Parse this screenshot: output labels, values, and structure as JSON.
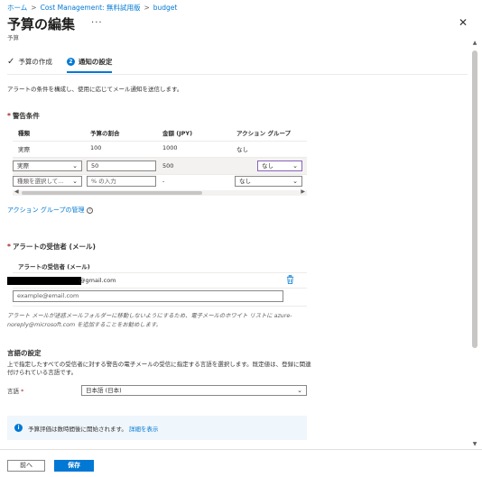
{
  "breadcrumb": [
    "ホーム",
    "Cost Management: 無料試用版",
    "budget"
  ],
  "header": {
    "title": "予算の編集",
    "more": "···",
    "subtitle": "予算",
    "close": "✕"
  },
  "steps": [
    {
      "label": "予算の作成",
      "state": "done"
    },
    {
      "label": "通知の設定",
      "number": "2",
      "state": "active"
    }
  ],
  "description": "アラートの条件を構成し、使用に応じてメール通知を送信します。",
  "alert_conditions": {
    "required_mark": "*",
    "title": "警告条件",
    "columns": [
      "種類",
      "予算の割合",
      "金額 (JPY)",
      "アクション グループ"
    ],
    "rows": [
      {
        "type": "実際",
        "percent": "100",
        "amount": "1000",
        "action_group": "なし"
      },
      {
        "type": "実際",
        "percent": "50",
        "amount": "500",
        "action_group": "なし"
      },
      {
        "type_placeholder": "種類を選択して...",
        "percent_placeholder": "% の入力",
        "amount": "-",
        "action_group": "なし"
      }
    ],
    "manage_link": "アクション グループの管理"
  },
  "recipients": {
    "required_mark": "*",
    "title": "アラートの受信者 (メール)",
    "column": "アラートの受信者 (メール)",
    "email_suffix": "@gmail.com",
    "placeholder": "example@email.com",
    "note": "アラート メールが迷惑メールフォルダーに移動しないようにするため、電子メールのホワイト リストに azure-noreply@microsoft.com を追加することをお勧めします。"
  },
  "language": {
    "title": "言語の設定",
    "description": "上で指定したすべての受信者に対する警告の電子メールの受信に指定する言語を選択します。既定値は、登録に関連付けられている言語です。",
    "label": "言語",
    "required_mark": "*",
    "value": "日本語 (日本)"
  },
  "info": {
    "icon": "i",
    "text": "予算評価は数時間後に開始されます。",
    "link": "詳細を表示"
  },
  "footer": {
    "prev": "前へ",
    "save": "保存"
  },
  "colors": {
    "accent": "#0078d4",
    "required": "#a4262c",
    "info_bg": "#eff6fc",
    "active_border": "#8764b8"
  }
}
